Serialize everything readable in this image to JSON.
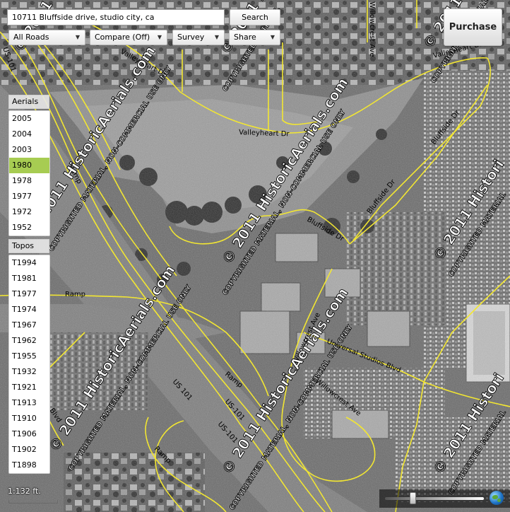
{
  "search": {
    "value": "10711 Bluffside drive, studio city, ca",
    "button_label": "Search"
  },
  "toolbar": {
    "roads_label": "All Roads",
    "compare_label": "Compare (Off)",
    "survey_label": "Survey",
    "share_label": "Share"
  },
  "purchase_label": "Purchase",
  "aerials": {
    "header": "Aerials",
    "years": [
      "2005",
      "2004",
      "2003",
      "1980",
      "1978",
      "1977",
      "1972",
      "1952"
    ],
    "selected": "1980"
  },
  "topos": {
    "header": "Topos",
    "years": [
      "T1994",
      "T1981",
      "T1977",
      "T1974",
      "T1967",
      "T1962",
      "T1955",
      "T1932",
      "T1921",
      "T1913",
      "T1910",
      "T1906",
      "T1902",
      "T1898"
    ]
  },
  "map": {
    "roads": {
      "valleyheart_1": "Valleyheart Dr",
      "valleyheart_2": "Valleyheart Dr",
      "valleyheart_3": "Valleyheart Dr",
      "bluffside_1": "Bluffside Dr",
      "bluffside_2": "Bluffside Dr",
      "bluffside_3": "Bluffside Dr",
      "ramp_1": "Ramp",
      "ramp_2": "Ramp",
      "ramp_3": "Ramp",
      "ramp_4": "Ramp",
      "us101_1": "US-101",
      "us101_2": "US 101",
      "us101_3": "US-101",
      "us101_4": "US-101",
      "willowcrest_1": "Willowcrest Ave",
      "willowcrest_2": "Willowcrest Ave",
      "willowcrest_3": "Willowcrest Ave",
      "universal": "Universal Studios Blvd",
      "blvd": "Blvd"
    },
    "watermark": {
      "line1": "© 2011 HistoricAerials.com",
      "line2": "COPYRIGHTED MATERIAL, NON-COMMERCIAL USE ONLY",
      "line3": "COPYRIGHTED MATERIAL",
      "line4": "© 2011 Histori"
    },
    "road_color": "#f2e632"
  },
  "scale_label": "1:132 ft.",
  "zoom_level": 0.28
}
